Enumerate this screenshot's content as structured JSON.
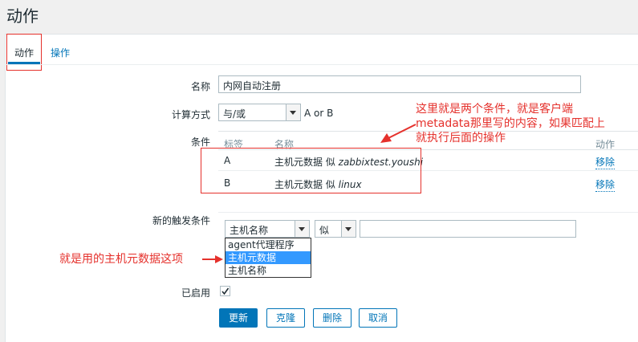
{
  "page_title": "动作",
  "tabs": [
    {
      "label": "动作"
    },
    {
      "label": "操作"
    }
  ],
  "form": {
    "name_label": "名称",
    "name_value": "内网自动注册",
    "calc_label": "计算方式",
    "calc_value": "与/或",
    "calc_formula": "A or B",
    "conditions_label": "条件",
    "conditions_headers": {
      "tag": "标签",
      "name": "名称",
      "action": "动作"
    },
    "conditions": [
      {
        "tag": "A",
        "name_prefix": "主机元数据 似 ",
        "name_value": "zabbixtest.youshi",
        "action": "移除"
      },
      {
        "tag": "B",
        "name_prefix": "主机元数据 似 ",
        "name_value": "linux",
        "action": "移除"
      }
    ],
    "new_condition_label": "新的触发条件",
    "new_condition_type": "主机名称",
    "new_condition_op": "似",
    "new_condition_value": "",
    "dropdown_options": [
      "agent代理程序",
      "主机元数据",
      "主机名称"
    ],
    "enabled_label": "已启用",
    "buttons": {
      "update": "更新",
      "clone": "克隆",
      "delete": "删除",
      "cancel": "取消"
    }
  },
  "annotations": {
    "note1_lines": [
      "这里就是两个条件，就是客户端",
      "metadata那里写的内容，如果匹配上",
      "就执行后面的操作"
    ],
    "note2": "就是用的主机元数据这项"
  },
  "colors": {
    "accent": "#0275b8",
    "annotation": "#e5312c"
  }
}
